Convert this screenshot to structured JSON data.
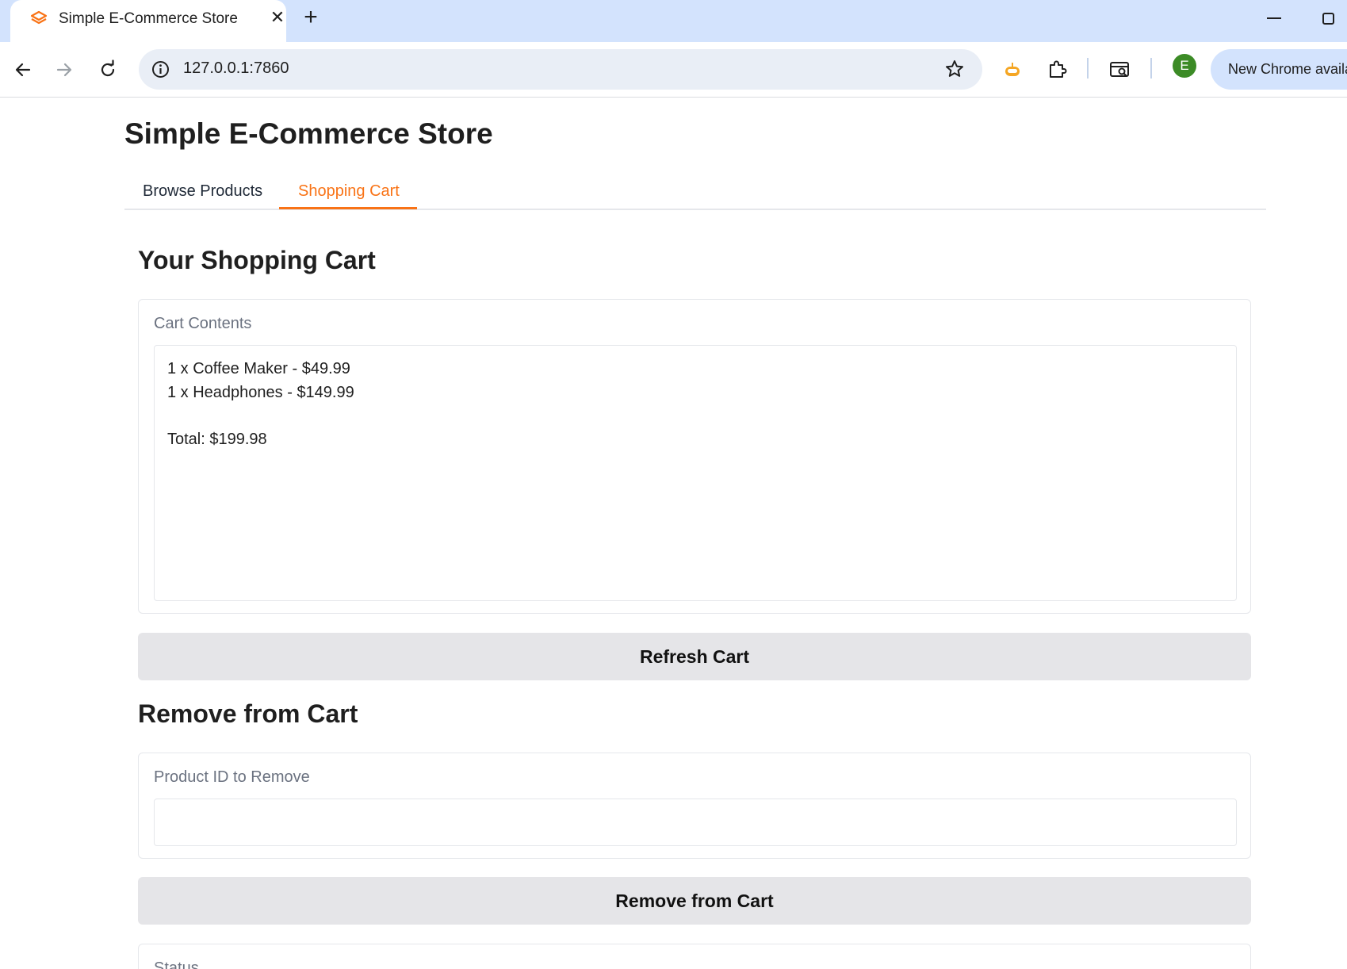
{
  "browser": {
    "tab_title": "Simple E-Commerce Store",
    "url": "127.0.0.1:7860",
    "profile_initial": "E",
    "update_label": "New Chrome availa"
  },
  "app": {
    "title": "Simple E-Commerce Store",
    "tabs": [
      {
        "label": "Browse Products",
        "active": false
      },
      {
        "label": "Shopping Cart",
        "active": true
      }
    ],
    "accent_color": "#f97316"
  },
  "cart": {
    "heading": "Your Shopping Cart",
    "contents_label": "Cart Contents",
    "items": [
      "1 x Coffee Maker - $49.99",
      "1 x Headphones - $149.99"
    ],
    "total": "Total: $199.98",
    "refresh_label": "Refresh Cart"
  },
  "remove": {
    "heading": "Remove from Cart",
    "field_label": "Product ID to Remove",
    "field_value": "",
    "button_label": "Remove from Cart"
  },
  "status": {
    "label": "Status"
  }
}
